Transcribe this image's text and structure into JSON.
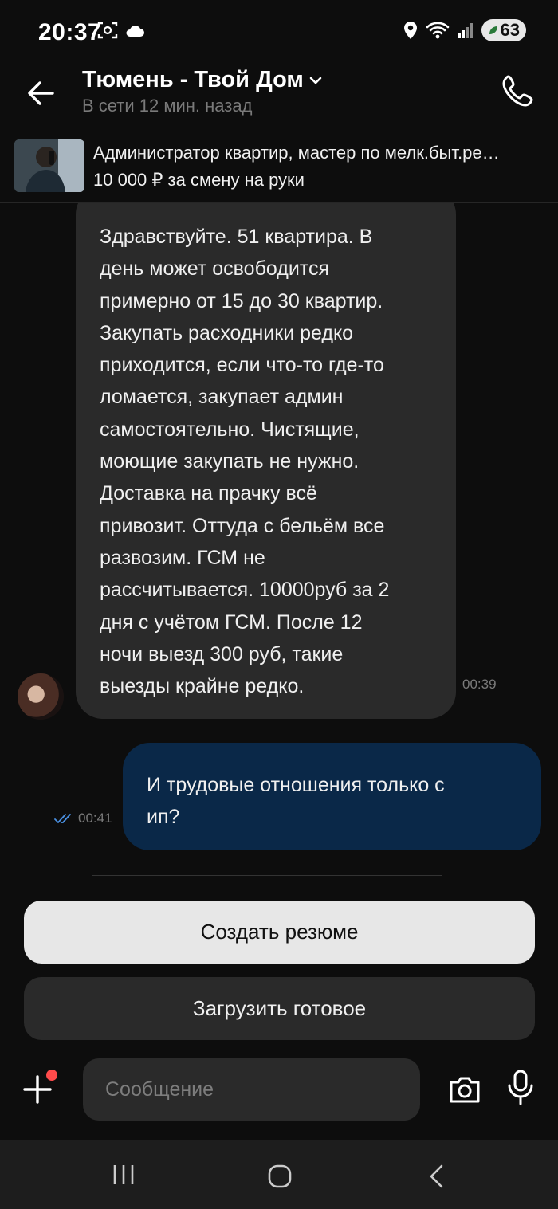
{
  "status_bar": {
    "time": "20:37",
    "battery": "63",
    "icons": [
      "screenshot-icon",
      "cloud-icon",
      "location-icon",
      "wifi-icon",
      "signal-icon",
      "battery-icon"
    ]
  },
  "header": {
    "title": "Тюмень - Твой Дом",
    "subtitle": "В сети 12 мин. назад"
  },
  "vacancy": {
    "title": "Администратор квартир, мастер по мелк.быт.ре…",
    "salary": "10 000 ₽ за смену на руки"
  },
  "messages": [
    {
      "direction": "incoming",
      "lines": [
        "Здравствуйте. 51 квартира. В",
        "день может освободится",
        "примерно от 15 до 30 квартир.",
        "Закупать расходники редко",
        "приходится, если что-то где-то",
        "ломается, закупает админ",
        "самостоятельно. Чистящие,",
        "моющие закупать не нужно.",
        "Доставка на прачку всё",
        "привозит. Оттуда с бельём все",
        "развозим. ГСМ не",
        "рассчитывается. 10000руб за 2",
        "дня с учётом ГСМ. После 12",
        "ночи выезд 300 руб, такие",
        "выезды крайне редко."
      ],
      "time": "00:39"
    },
    {
      "direction": "outgoing",
      "lines": [
        "И трудовые отношения только  с",
        "ип?"
      ],
      "time": "00:41",
      "status": "read"
    }
  ],
  "actions": {
    "create_resume": "Создать резюме",
    "upload_ready": "Загрузить готовое"
  },
  "composer": {
    "placeholder": "Сообщение"
  },
  "colors": {
    "background": "#0d0d0d",
    "incoming_bubble": "#2a2a2a",
    "outgoing_bubble": "#0a2848",
    "read_check": "#4a90e2",
    "notification_dot": "#ff4b4b"
  }
}
